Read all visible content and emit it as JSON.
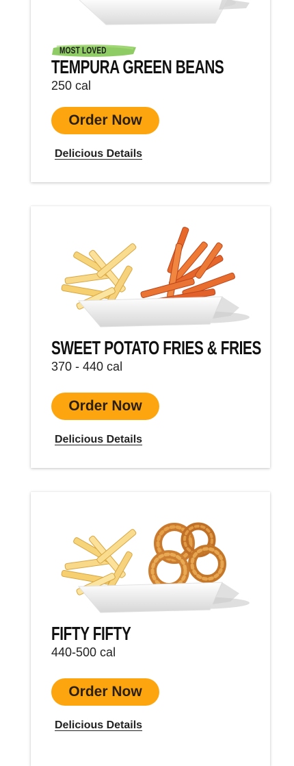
{
  "items": [
    {
      "badge": "MOST LOVED",
      "name": "TEMPURA GREEN BEANS",
      "calories": "250 cal",
      "order_label": "Order Now",
      "details_label": "Delicious Details",
      "image": "green-beans-tray-image"
    },
    {
      "name": "SWEET POTATO FRIES & FRIES",
      "calories": "370 - 440 cal",
      "order_label": "Order Now",
      "details_label": "Delicious Details",
      "image": "sweet-potato-fries-and-fries-image"
    },
    {
      "name": "FIFTY FIFTY",
      "calories": "440-500 cal",
      "order_label": "Order Now",
      "details_label": "Delicious Details",
      "image": "fries-and-onion-rings-image"
    }
  ],
  "colors": {
    "button": "#fca50f",
    "badge_brush": "#7cc34a",
    "text": "#111111"
  }
}
